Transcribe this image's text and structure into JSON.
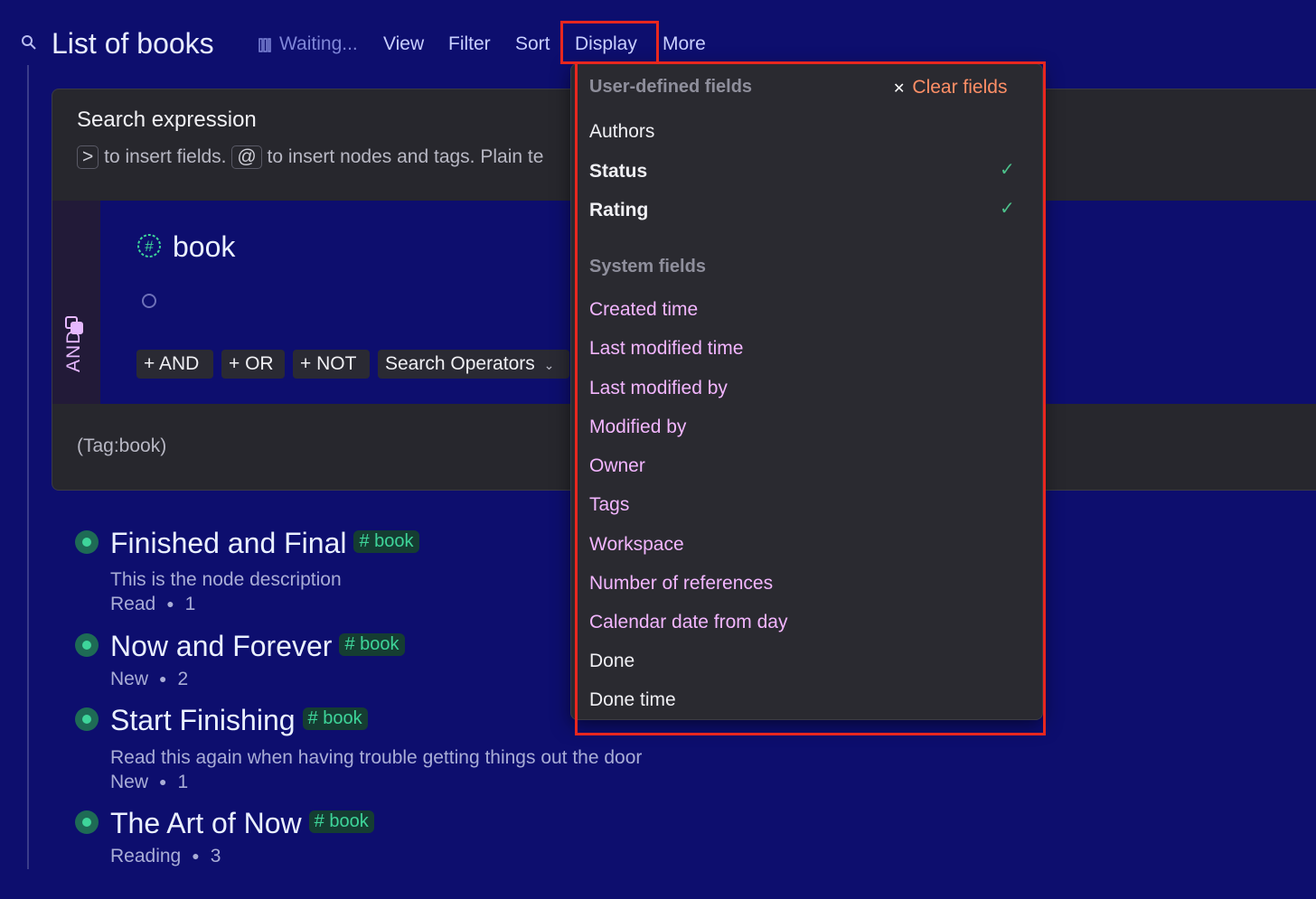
{
  "header": {
    "title": "List of books",
    "status": "Waiting...",
    "menu": [
      "View",
      "Filter",
      "Sort",
      "Display",
      "More"
    ]
  },
  "search": {
    "heading": "Search expression",
    "hint_key1": ">",
    "hint_text1": "to insert fields.",
    "hint_key2": "@",
    "hint_text2": "to insert nodes and tags. Plain te",
    "group_label": "AND",
    "tag_node": "book",
    "buttons": [
      "+ AND",
      "+ OR",
      "+ NOT",
      "Search Operators"
    ],
    "query": "(Tag:book)"
  },
  "items": [
    {
      "title": "Finished and Final",
      "tag": "# book",
      "description": "This is the node description",
      "status": "Read",
      "rating": "1"
    },
    {
      "title": "Now and Forever",
      "tag": "# book",
      "description": "",
      "status": "New",
      "rating": "2"
    },
    {
      "title": "Start Finishing",
      "tag": "# book",
      "description": "Read this again when having trouble getting things out the door",
      "status": "New",
      "rating": "1"
    },
    {
      "title": "The Art of Now",
      "tag": "# book",
      "description": "",
      "status": "Reading",
      "rating": "3"
    }
  ],
  "display_menu": {
    "user_heading": "User-defined fields",
    "clear_label": "Clear fields",
    "user_fields": [
      {
        "label": "Authors",
        "checked": false
      },
      {
        "label": "Status",
        "checked": true
      },
      {
        "label": "Rating",
        "checked": true
      }
    ],
    "system_heading": "System fields",
    "system_fields": [
      "Created time",
      "Last modified time",
      "Last modified by",
      "Modified by",
      "Owner",
      "Tags",
      "Workspace",
      "Number of references",
      "Calendar date from day",
      "Done",
      "Done time"
    ]
  },
  "colors": {
    "background": "#0d0e6e",
    "tag_green": "#3ed59a",
    "system_field_pink": "#f3b6ff",
    "clear_orange": "#ff8f66",
    "highlight_red": "#e8271f"
  },
  "icons": [
    "search-icon",
    "columns-icon",
    "tag-hash-icon",
    "checkmark-icon",
    "close-icon",
    "chevron-down-icon",
    "group-icon"
  ]
}
